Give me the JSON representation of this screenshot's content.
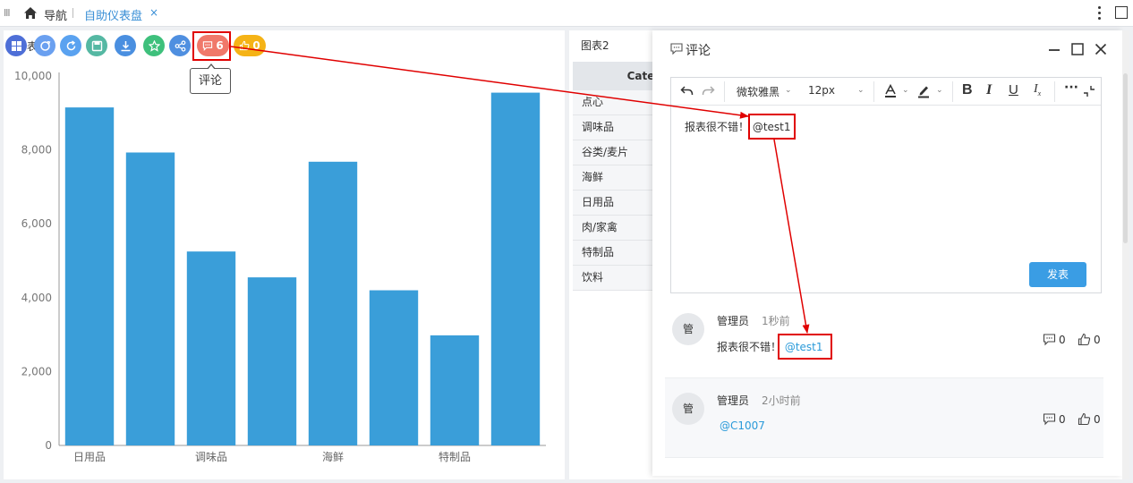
{
  "topbar": {
    "grip": "Ⅲ",
    "home_label": "导航",
    "active_tab": "自助仪表盘",
    "close": "×"
  },
  "chart_toolbar": {
    "hidden_label": "表",
    "comment_count": "6",
    "like_count": "0",
    "tooltip": "评论",
    "colors": {
      "grid_btn": "#4e6fd7",
      "refresh1": "#6aa0f0",
      "refresh2": "#5aa2f0",
      "save": "#55b8a3",
      "download": "#4a8fe0",
      "star": "#3ec07c",
      "share": "#4f8fe0",
      "comment": "#f0786a",
      "like": "#f5b316"
    }
  },
  "chart_data": {
    "type": "bar",
    "categories": [
      "日用品",
      "",
      "调味品",
      "",
      "海鲜",
      "",
      "特制品",
      ""
    ],
    "values": [
      9150,
      7930,
      5250,
      4550,
      7680,
      4200,
      2980,
      9550
    ],
    "y_ticks": [
      "0",
      "2,000",
      "4,000",
      "6,000",
      "8,000",
      "10,000"
    ],
    "ylim": [
      0,
      10000
    ],
    "color": "#3a9ed9",
    "grid": false
  },
  "data_panel": {
    "title": "图表2",
    "header": "Categ",
    "rows": [
      "点心",
      "调味品",
      "谷类/麦片",
      "海鲜",
      "日用品",
      "肉/家禽",
      "特制品",
      "饮料"
    ]
  },
  "comment_window": {
    "title": "评论",
    "editor": {
      "font": "微软雅黑",
      "size": "12px",
      "text": "报表很不错！",
      "mention": "@test1",
      "send": "发表"
    },
    "comments": [
      {
        "avatar": "管",
        "user": "管理员",
        "time": "1秒前",
        "text": "报表很不错！",
        "mention": "@test1",
        "replies": "0",
        "likes": "0"
      },
      {
        "avatar": "管",
        "user": "管理员",
        "time": "2小时前",
        "text": "",
        "mention": "@C1007",
        "replies": "0",
        "likes": "0"
      }
    ]
  }
}
